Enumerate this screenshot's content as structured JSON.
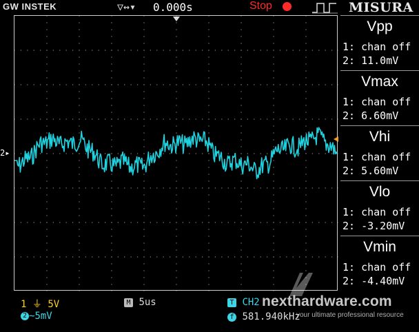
{
  "header": {
    "brand": "GW INSTEK",
    "trigger_icons": "▽↔▾",
    "trigger_time": "0.000s",
    "run_state": "Stop",
    "run_state_color": "#ff2a2a",
    "measure_title": "MISURA"
  },
  "grid": {
    "ch2_marker": "2▸",
    "trace_color": "#1fd2e0"
  },
  "measurements": [
    {
      "name": "Vpp",
      "ch1": "1: chan off",
      "ch2": "2: 11.0mV"
    },
    {
      "name": "Vmax",
      "ch1": "1: chan off",
      "ch2": "2: 6.60mV"
    },
    {
      "name": "Vhi",
      "ch1": "1: chan off",
      "ch2": "2: 5.60mV"
    },
    {
      "name": "Vlo",
      "ch1": "1: chan off",
      "ch2": "2: -3.20mV"
    },
    {
      "name": "Vmin",
      "ch1": "1: chan off",
      "ch2": "2: -4.40mV"
    }
  ],
  "status": {
    "ch1_num": "1",
    "ch1_coupling": "⏚",
    "ch1_scale": "5V",
    "ch2_num": "2",
    "ch2_coupling": "~",
    "ch2_scale": "5mV",
    "timebase_label": "M",
    "timebase": "5us",
    "trigger_label": "T",
    "trigger_source": "CH2",
    "freq_label": "f",
    "frequency": "581.940kHz"
  },
  "watermark": {
    "site": "nexthardware.com",
    "tagline": "your ultimate professional resource"
  },
  "colors": {
    "ch1": "#ffd21a",
    "ch2": "#3cd6e6",
    "grid_dots": "#8a8a8a"
  }
}
